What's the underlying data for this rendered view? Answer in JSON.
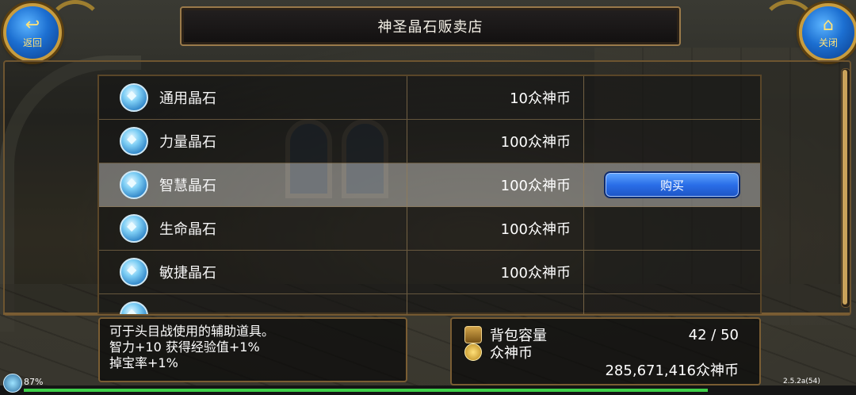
{
  "header": {
    "title": "神圣晶石贩卖店",
    "back_label": "返回",
    "close_label": "关闭",
    "back_icon": "back-arrow-icon",
    "close_icon": "home-icon"
  },
  "items": [
    {
      "name": "通用晶石",
      "price": "10众神币"
    },
    {
      "name": "力量晶石",
      "price": "100众神币"
    },
    {
      "name": "智慧晶石",
      "price": "100众神币",
      "selected": true
    },
    {
      "name": "生命晶石",
      "price": "100众神币"
    },
    {
      "name": "敏捷晶石",
      "price": "100众神币"
    }
  ],
  "buy_label": "购买",
  "description": {
    "line1": "可于头目战使用的辅助道具。",
    "line2": "智力+10 获得经验值+1%",
    "line3": "掉宝率+1%"
  },
  "bag": {
    "capacity_label": "背包容量",
    "capacity_value": "42 / 50",
    "currency_label": "众神币",
    "currency_value": "285,671,416众神币"
  },
  "status": {
    "battery": "87%",
    "version": "2.5.2a(54)",
    "xp_fraction": 0.83
  },
  "colors": {
    "accent_gold": "#c79c3f",
    "button_blue": "#2a6ee8",
    "xp_green": "#3fd04a"
  }
}
